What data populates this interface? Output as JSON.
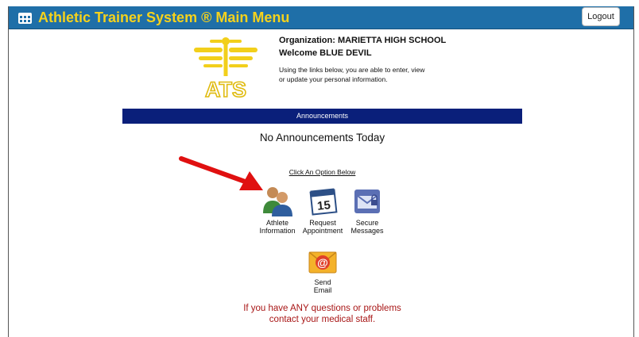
{
  "header": {
    "title": "Athletic Trainer System ® Main Menu",
    "menu_icon": "grid-menu-icon",
    "logout_label": "Logout"
  },
  "logo": {
    "text": "ATS",
    "icon": "ats-caduceus-logo"
  },
  "organization": {
    "line1": "Organization: MARIETTA HIGH SCHOOL",
    "line2": "Welcome BLUE DEVIL",
    "description": "Using the links below, you are able to enter, view or update your personal information."
  },
  "announcements": {
    "header": "Announcements",
    "message": "No Announcements Today"
  },
  "options": {
    "prompt": "Click An Option Below",
    "items": [
      {
        "icon": "athlete-people-icon",
        "line1": "Athlete",
        "line2": "Information"
      },
      {
        "icon": "calendar-15-icon",
        "line1": "Request",
        "line2": "Appointment"
      },
      {
        "icon": "secure-message-envelope-icon",
        "line1": "Secure",
        "line2": "Messages"
      },
      {
        "icon": "email-at-icon",
        "line1": "Send",
        "line2": "Email"
      }
    ],
    "calendar_number": "15"
  },
  "footer": {
    "line1": "If you have ANY questions or problems",
    "line2": "contact your medical staff."
  },
  "colors": {
    "header_bg": "#1f6fa8",
    "title_yellow": "#f5d21c",
    "announcement_bar": "#0a1f7a",
    "contact_red": "#a81616",
    "arrow_red": "#e01010"
  }
}
